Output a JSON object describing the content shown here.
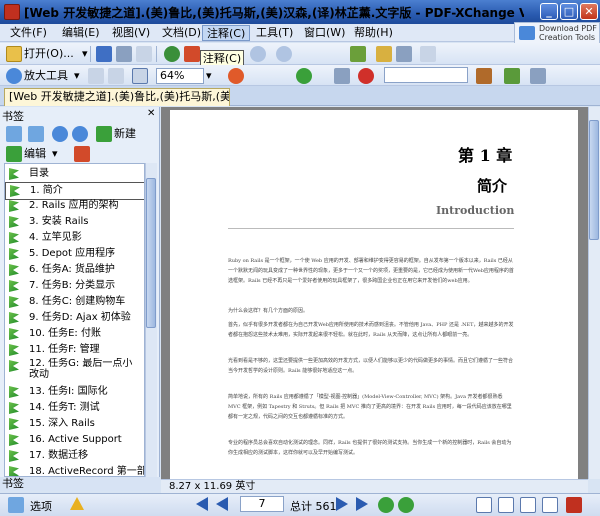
{
  "window": {
    "title": "[Web 开发敏捷之道].(美)鲁比,(美)托马斯,(美)汉森,(译)林芷薰.文字版 - PDF-XChange Viewer"
  },
  "menubar": {
    "items": [
      "文件(F)",
      "编辑(E)",
      "视图(V)",
      "文档(D)",
      "注释(C)",
      "工具(T)",
      "窗口(W)",
      "帮助(H)"
    ]
  },
  "download_badge": {
    "line1": "Download PDF",
    "line2": "Creation Tools"
  },
  "toolbar1": {
    "open_label": "打开(O)...",
    "tooltip": "注释(C)"
  },
  "toolbar2": {
    "zoom_tool_label": "放大工具",
    "zoom_value": "64%"
  },
  "doc_tab": {
    "label": "[Web 开发敏捷之道].(美)鲁比,(美)托马斯,(美)..."
  },
  "bookmarks": {
    "header": "书签",
    "new_label": "新建",
    "edit_label": "编辑",
    "items": [
      "目录",
      "1. 简介",
      "2. Rails 应用的架构",
      "3. 安装 Rails",
      "4. 立竿见影",
      "5. Depot 应用程序",
      "6. 任务A: 货品维护",
      "7. 任务B: 分类显示",
      "8. 任务C: 创建购物车",
      "9. 任务D: Ajax 初体验",
      "10. 任务E: 付账",
      "11. 任务F: 管理",
      "12. 任务G: 最后一点小改动",
      "13. 任务I: 国际化",
      "14. 任务T: 测试",
      "15. 深入 Rails",
      "16. Active Support",
      "17. 数据迁移",
      "18. ActiveRecord 第一部"
    ],
    "bottom_tab": "书签"
  },
  "page": {
    "chapter": "第 1 章",
    "title": "简介",
    "title_en": "Introduction",
    "paragraphs": [
      "Ruby on Rails 是一个框架，一个使 Web 应用的开发、部署和维护变得更容易的框架。自从发布第一个版本以来，Rails 已经从一个默默无闻的玩具变成了一种世界性的现象，更多于一个又一个的奖项，更重要的是，它已经成为使用新一代Web应用程序的首选框架。Rails 已经不再只是一个爱好者使用的玩具框架了，很多跨国企业也正在用它来开发他们的web应用。",
      "为什么会这样？有几个方面的原因。",
      "首先，似乎有很多开发者都在为自己开发Web应用所使用的技术而感到沮丧。不管他用 Java、PHP 还是 .NET，越来越多的开发者都在抱怨这些技术太难用，实际开发起来很不轻松。就在此时，Rails 从天而降，这点让所有人都眼前一亮。",
      "光看到看是不够的，这里还要提供一些更加高效的开发方式，以便人们能够以更少的代码做更多的事情。而且它们遵循了一些符合当今开发哲学的设计原则。Rails 能够很好地适应这一点。",
      "简单地说，所有的 Rails 应用都遵循了「模型-视图-控制器」(Model-View-Controller, MVC) 架构。Java 开发者都很熟悉 MVC 框架，例如 Tapestry 和 Struts。但 Rails 把 MVC 推向了更高的境界：在开发 Rails 应用时，每一段代码应该放在哪里都有一定之规，代码之间的交互也都遵循标准的方式。",
      "专业的程序员总会喜欢自动化测试的理念。同样，Rails 也提供了很好的测试支持。当你生成一个新的控制器时，Rails 会自动为你生成相应的测试脚本，这样你就可以及早开始编写测试。"
    ]
  },
  "status": {
    "page_size": "8.27 x 11.69 英寸",
    "options_label": "选项",
    "current_page": "7",
    "total_pages": "总计 561"
  }
}
